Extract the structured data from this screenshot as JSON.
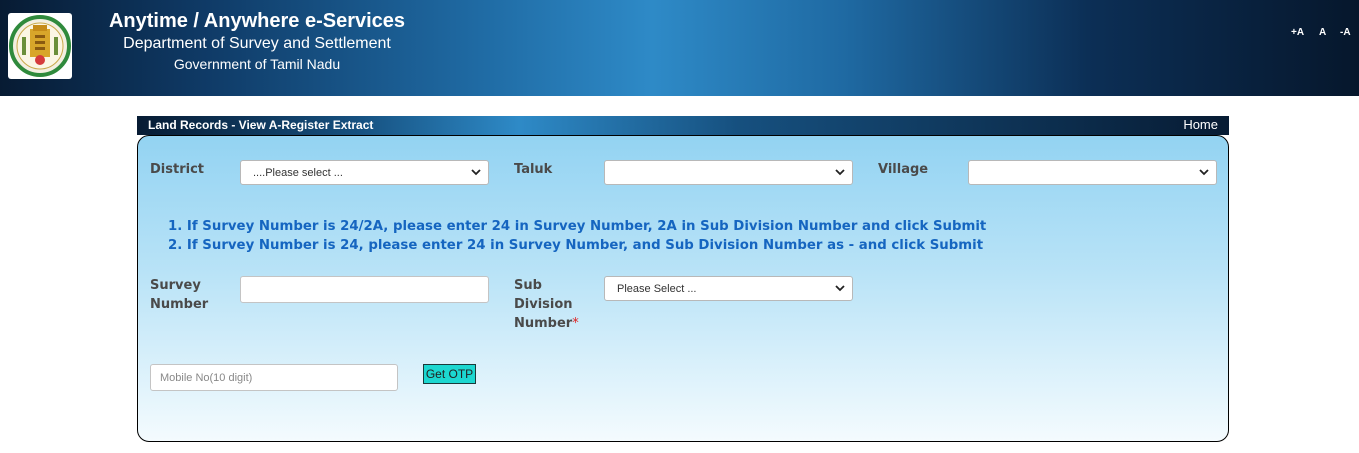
{
  "header": {
    "title": "Anytime / Anywhere e-Services",
    "department": "Department of Survey and Settlement",
    "government": "Government of Tamil Nadu",
    "font_controls": [
      "+A",
      "A",
      "-A"
    ]
  },
  "section": {
    "title": "Land Records - View A-Register Extract",
    "home_link": "Home"
  },
  "form": {
    "district_label": "District",
    "district_value": "....Please select ...",
    "taluk_label": "Taluk",
    "taluk_value": "",
    "village_label": "Village",
    "village_value": "",
    "instructions": [
      "1. If Survey Number is 24/2A, please enter 24 in Survey Number, 2A in Sub Division Number and click Submit",
      "2. If Survey Number is 24, please enter 24 in Survey Number, and Sub Division Number as - and click Submit"
    ],
    "survey_label_line1": "Survey",
    "survey_label_line2": "Number",
    "survey_value": "",
    "subdiv_label_line1": "Sub",
    "subdiv_label_line2": "Division",
    "subdiv_label_line3": "Number",
    "required_mark": "*",
    "subdiv_value": "Please Select ...",
    "mobile_placeholder": "Mobile No(10 digit)",
    "otp_button": "Get OTP"
  },
  "colors": {
    "instruction_text": "#1565c0",
    "otp_button_bg": "#1cd7d0",
    "required": "#e02020"
  }
}
